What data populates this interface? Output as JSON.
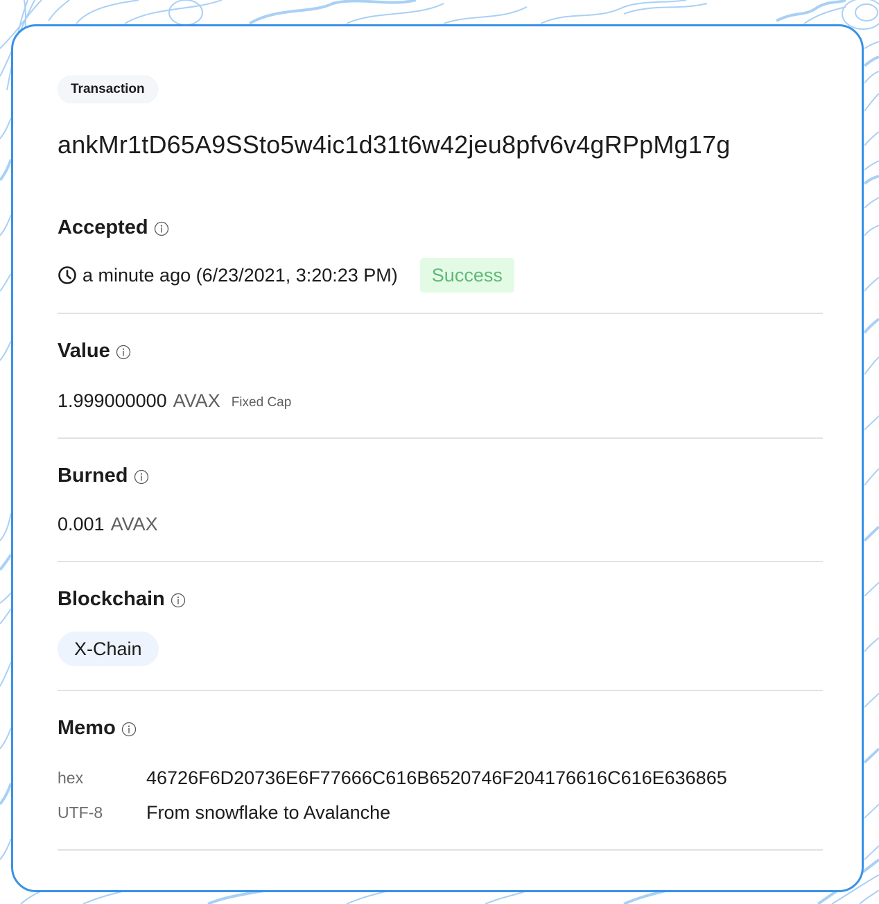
{
  "transaction": {
    "type_label": "Transaction",
    "id": "ankMr1tD65A9SSto5w4ic1d31t6w42jeu8pfv6v4gRPpMg17g"
  },
  "accepted": {
    "heading": "Accepted",
    "info_icon": "info-circle-icon",
    "clock_icon": "clock-icon",
    "time_text": "a minute ago (6/23/2021, 3:20:23 PM)",
    "status": "Success"
  },
  "value": {
    "heading": "Value",
    "info_icon": "info-circle-icon",
    "amount": "1.999000000",
    "unit": "AVAX",
    "cap_label": "Fixed Cap"
  },
  "burned": {
    "heading": "Burned",
    "info_icon": "info-circle-icon",
    "amount": "0.001",
    "unit": "AVAX"
  },
  "blockchain": {
    "heading": "Blockchain",
    "info_icon": "info-circle-icon",
    "chain": "X-Chain"
  },
  "memo": {
    "heading": "Memo",
    "info_icon": "info-circle-icon",
    "rows": [
      {
        "label": "hex",
        "value": "46726F6D20736E6F77666C616B6520746F204176616C616E636865"
      },
      {
        "label": "UTF-8",
        "value": "From snowflake to Avalanche"
      }
    ]
  },
  "colors": {
    "card_border": "#3891e6",
    "status_bg": "#e3fbe5",
    "status_text": "#5fb877",
    "chain_pill_bg": "#edf4fd",
    "background_pattern": "#a9d0f5"
  }
}
